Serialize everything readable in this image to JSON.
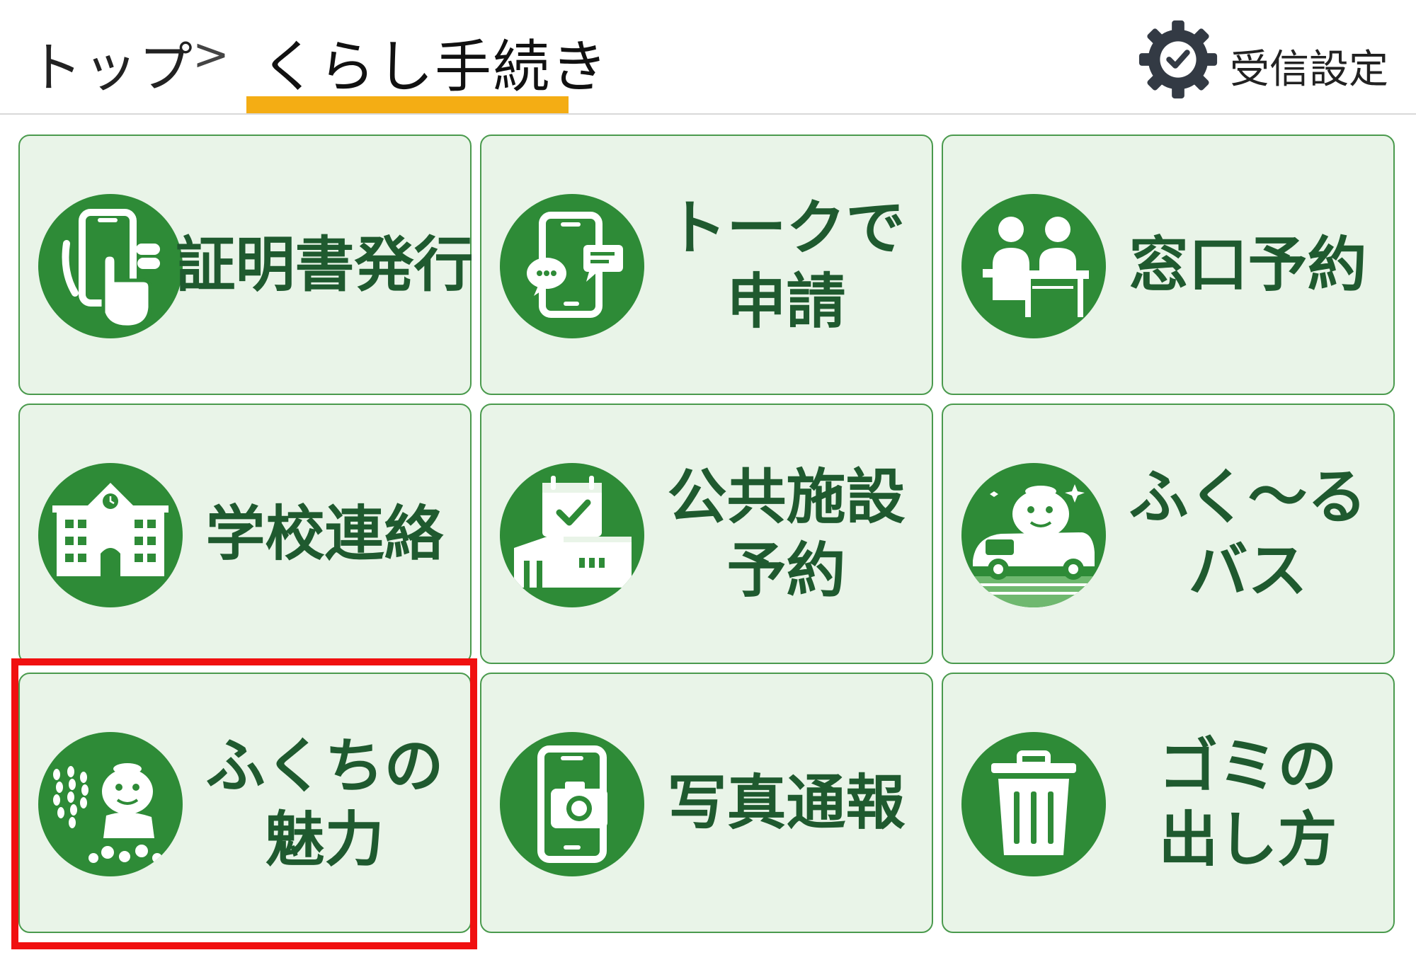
{
  "header": {
    "breadcrumb_top": "トップ",
    "breadcrumb_separator": ">",
    "breadcrumb_current": "くらし手続き",
    "settings_label": "受信設定"
  },
  "tiles": [
    {
      "line1": "証明書発行",
      "line2": "",
      "icon": "smartphone-hand-icon"
    },
    {
      "line1": "トークで",
      "line2": "申請",
      "icon": "smartphone-chat-icon"
    },
    {
      "line1": "窓口予約",
      "line2": "",
      "icon": "counter-people-icon"
    },
    {
      "line1": "学校連絡",
      "line2": "",
      "icon": "school-icon"
    },
    {
      "line1": "公共施設",
      "line2": "予約",
      "icon": "facility-calendar-icon"
    },
    {
      "line1": "ふく～る",
      "line2": "バス",
      "icon": "mascot-bus-icon"
    },
    {
      "line1": "ふくちの",
      "line2": "魅力",
      "icon": "mascot-wisteria-icon"
    },
    {
      "line1": "写真通報",
      "line2": "",
      "icon": "smartphone-camera-icon"
    },
    {
      "line1": "ゴミの",
      "line2": "出し方",
      "icon": "trash-can-icon"
    }
  ],
  "colors": {
    "tile_background": "#e9f4e8",
    "tile_border": "#4a9a4d",
    "icon_circle": "#2e8b37",
    "label_text": "#1f5a2f",
    "breadcrumb_underline": "#f4ad14",
    "highlight_box": "#f01010"
  }
}
